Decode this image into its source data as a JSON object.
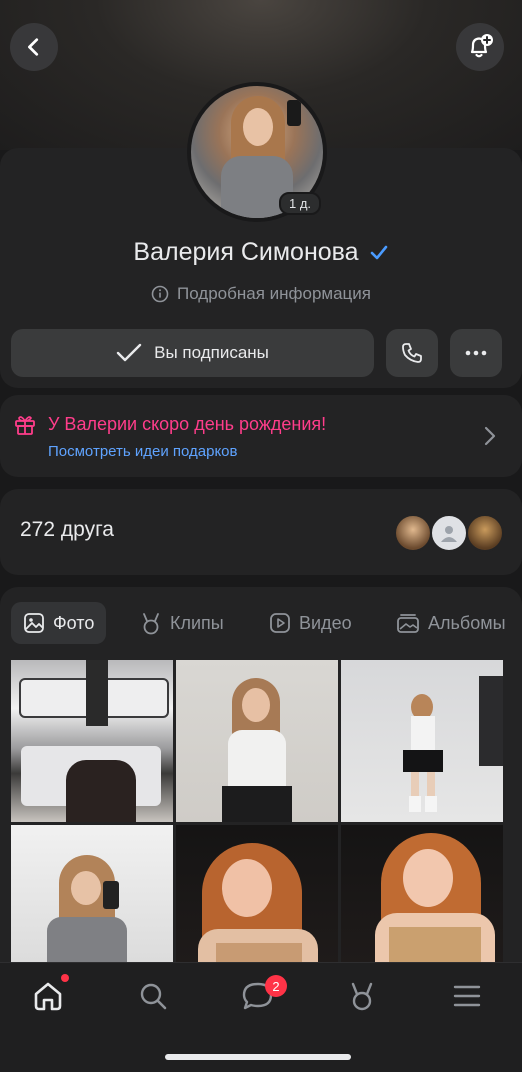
{
  "profile": {
    "name": "Валерия Симонова",
    "story_age": "1 д.",
    "info_link": "Подробная информация",
    "subscribed_label": "Вы подписаны"
  },
  "birthday": {
    "title": "У Валерии скоро день рождения!",
    "link": "Посмотреть идеи подарков"
  },
  "friends": {
    "count_label": "272 друга"
  },
  "media_tabs": [
    {
      "label": "Фото",
      "icon": "image-icon",
      "active": true
    },
    {
      "label": "Клипы",
      "icon": "clips-icon",
      "active": false
    },
    {
      "label": "Видео",
      "icon": "video-icon",
      "active": false
    },
    {
      "label": "Альбомы",
      "icon": "albums-icon",
      "active": false
    }
  ],
  "tabbar": {
    "items": [
      "home-icon",
      "search-icon",
      "messages-icon",
      "clips-icon",
      "menu-icon"
    ],
    "messages_badge": "2"
  },
  "colors": {
    "accent_blue": "#5fa3ff",
    "birthday_pink": "#ff3d8b",
    "badge_red": "#ff3347",
    "verified": "#4a9bff"
  }
}
